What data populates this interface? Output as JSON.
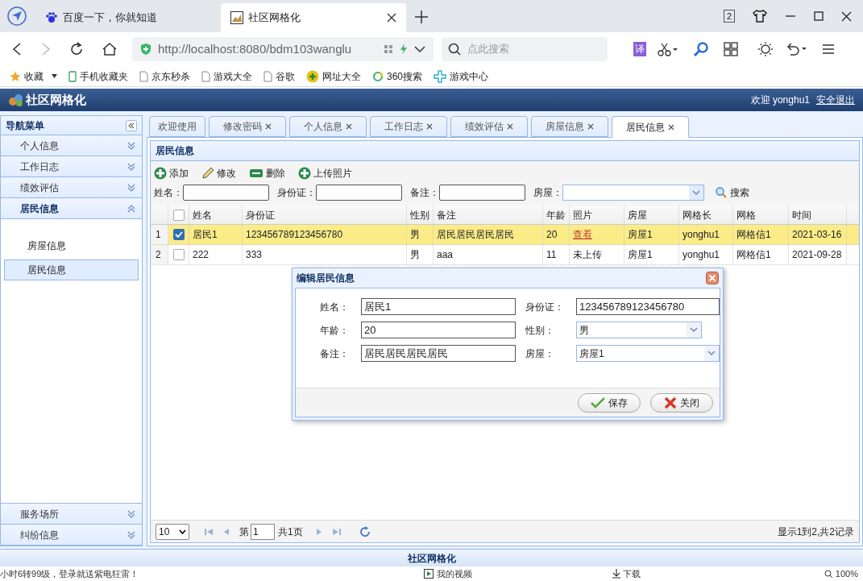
{
  "browser": {
    "tabs": [
      {
        "label": "百度一下，你就知道",
        "selected": false,
        "closable": false
      },
      {
        "label": "社区网格化",
        "selected": true,
        "closable": true
      }
    ],
    "tab_count": "2",
    "address": "http://localhost:8080/bdm103wanglu",
    "search_placeholder": "点此搜索",
    "translate": "译",
    "bookmarks": [
      {
        "label": "收藏",
        "kind": "star"
      },
      {
        "label": "手机收藏夹",
        "kind": "phone"
      },
      {
        "label": "京东秒杀",
        "kind": "page"
      },
      {
        "label": "游戏大全",
        "kind": "page"
      },
      {
        "label": "谷歌",
        "kind": "page"
      },
      {
        "label": "网址大全",
        "kind": "plus"
      },
      {
        "label": "360搜索",
        "kind": "ring"
      },
      {
        "label": "游戏中心",
        "kind": "game"
      }
    ]
  },
  "app": {
    "title": "社区网格化",
    "welcome": "欢迎 yonghu1",
    "logout": "安全退出"
  },
  "nav": {
    "title": "导航菜单",
    "sections": [
      {
        "label": "个人信息",
        "expanded": false
      },
      {
        "label": "工作日志",
        "expanded": false
      },
      {
        "label": "绩效评估",
        "expanded": false
      },
      {
        "label": "居民信息",
        "expanded": true,
        "children": [
          {
            "label": "房屋信息",
            "selected": false
          },
          {
            "label": "居民信息",
            "selected": true
          }
        ]
      },
      {
        "label": "服务场所",
        "expanded": false
      },
      {
        "label": "纠纷信息",
        "expanded": false
      }
    ]
  },
  "tabs": [
    {
      "label": "欢迎使用",
      "closable": false,
      "selected": false
    },
    {
      "label": "修改密码",
      "closable": true,
      "selected": false
    },
    {
      "label": "个人信息",
      "closable": true,
      "selected": false
    },
    {
      "label": "工作日志",
      "closable": true,
      "selected": false
    },
    {
      "label": "绩效评估",
      "closable": true,
      "selected": false
    },
    {
      "label": "房屋信息",
      "closable": true,
      "selected": false
    },
    {
      "label": "居民信息",
      "closable": true,
      "selected": true
    }
  ],
  "panel": {
    "title": "居民信息",
    "toolbar": [
      {
        "label": "添加",
        "kind": "add"
      },
      {
        "label": "修改",
        "kind": "edit"
      },
      {
        "label": "删除",
        "kind": "remove"
      },
      {
        "label": "上传照片",
        "kind": "add"
      }
    ],
    "filters": [
      {
        "label": "姓名：",
        "kind": "text"
      },
      {
        "label": "身份证：",
        "kind": "text"
      },
      {
        "label": "备注：",
        "kind": "text"
      },
      {
        "label": "房屋：",
        "kind": "select"
      }
    ],
    "search_button": "搜索"
  },
  "table": {
    "header_checked": false,
    "columns": [
      "姓名",
      "身份证",
      "性别",
      "备注",
      "年龄",
      "照片",
      "房屋",
      "网格长",
      "网格",
      "时间"
    ],
    "rows": [
      {
        "number": "1",
        "checked": true,
        "selected": true,
        "photo_link": true,
        "cells": [
          "居民1",
          "123456789123456780",
          "男",
          "居民居民居民居民",
          "20",
          "查看",
          "房屋1",
          "yonghu1",
          "网格信1",
          "2021-03-16"
        ]
      },
      {
        "number": "2",
        "checked": false,
        "selected": false,
        "photo_link": false,
        "cells": [
          "222",
          "333",
          "男",
          "aaa",
          "11",
          "未上传",
          "房屋1",
          "yonghu1",
          "网格信1",
          "2021-09-28"
        ]
      }
    ]
  },
  "pagination": {
    "page_size": "10",
    "before": "第",
    "page": "1",
    "after": "共1页",
    "summary": "显示1到2,共2记录"
  },
  "dialog": {
    "title": "编辑居民信息",
    "fields": [
      {
        "label": "姓名：",
        "value": "居民1",
        "kind": "text"
      },
      {
        "label": "身份证：",
        "value": "123456789123456780",
        "kind": "text"
      },
      {
        "label": "年龄：",
        "value": "20",
        "kind": "text"
      },
      {
        "label": "性别：",
        "value": "男",
        "kind": "select"
      },
      {
        "label": "备注：",
        "value": "居民居民居民居民",
        "kind": "text"
      },
      {
        "label": "房屋：",
        "value": "房屋1",
        "kind": "select"
      }
    ],
    "buttons": [
      {
        "label": "保存",
        "kind": "save"
      },
      {
        "label": "关闭",
        "kind": "close"
      }
    ]
  },
  "footer": "社区网格化",
  "status_bar": {
    "message": "小时6转99级，登录就送紫电狂雷！",
    "video": "我的视频",
    "download": "下载",
    "zoom": "100%"
  }
}
